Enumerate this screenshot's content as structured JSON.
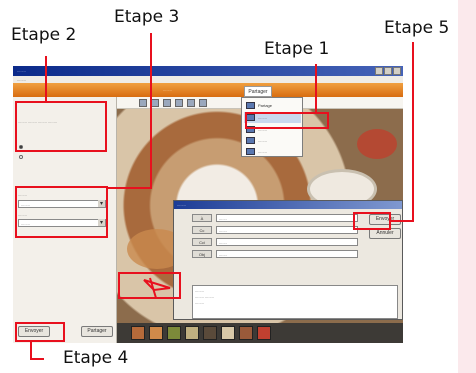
{
  "callouts": {
    "step2": "Etape 2",
    "step3": "Etape 3",
    "step1": "Etape 1",
    "step5": "Etape 5",
    "step4": "Etape 4"
  },
  "colors": {
    "callout_red": "#e8101e",
    "accent_orange": "#e07a1f",
    "title_blue": "#1c3c96"
  },
  "screenshot": {
    "menu_tab": "Partager",
    "left_panel": {
      "note": "........",
      "buttons": [
        "Envoyer",
        "Partager"
      ]
    },
    "dropdown_items": [
      "Partage",
      "........",
      "........",
      "........",
      "........"
    ],
    "dialog": {
      "title": "........",
      "fields": [
        ".......",
        ".......",
        ".......",
        "......."
      ],
      "buttons": [
        "Envoyer",
        "Annuler"
      ]
    }
  }
}
